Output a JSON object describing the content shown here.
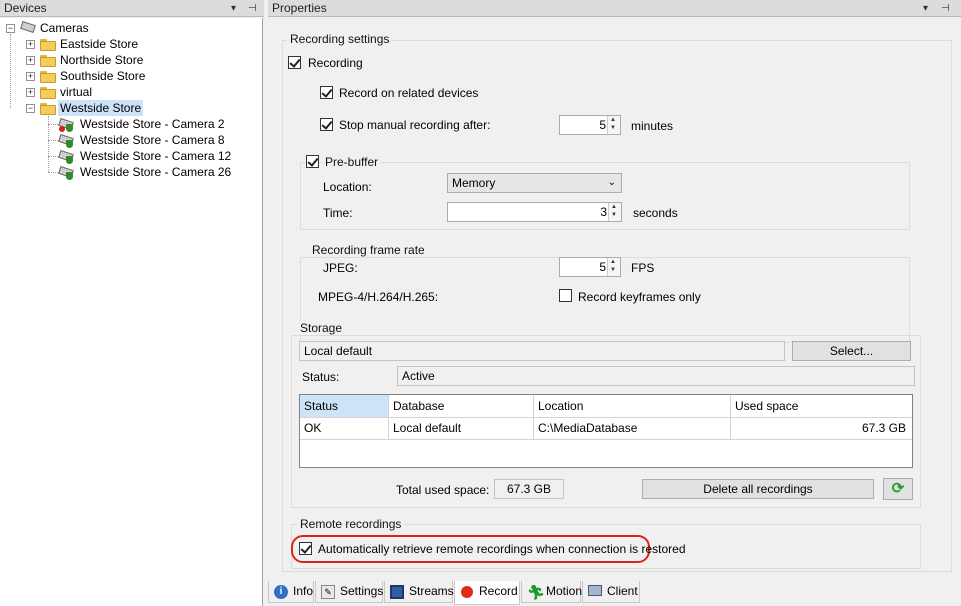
{
  "devices_pane": {
    "title": "Devices",
    "root": "Cameras",
    "folders": [
      "Eastside Store",
      "Northside Store",
      "Southside Store",
      "virtual",
      "Westside Store"
    ],
    "cameras": [
      "Westside Store - Camera 2",
      "Westside Store - Camera 8",
      "Westside Store - Camera 12",
      "Westside Store - Camera 26"
    ],
    "expander_plus": "+",
    "expander_minus": "−"
  },
  "properties_pane": {
    "title": "Properties",
    "pin_glyph": "▾ ⊣",
    "close_glyph": "✕"
  },
  "recording_settings": {
    "title": "Recording settings",
    "recording_label": "Recording",
    "recording_checked": true,
    "related_label": "Record on related devices",
    "related_checked": true,
    "stop_manual_label": "Stop manual recording after:",
    "stop_manual_checked": true,
    "stop_manual_value": "5",
    "stop_manual_unit": "minutes"
  },
  "prebuffer": {
    "title": "Pre-buffer",
    "checked": true,
    "location_label": "Location:",
    "location_value": "Memory",
    "time_label": "Time:",
    "time_value": "3",
    "time_unit": "seconds"
  },
  "frame_rate": {
    "title": "Recording frame rate",
    "jpeg_label": "JPEG:",
    "jpeg_value": "5",
    "jpeg_unit": "FPS",
    "mpeg_label": "MPEG-4/H.264/H.265:",
    "keyframes_label": "Record keyframes only",
    "keyframes_checked": false
  },
  "storage": {
    "title": "Storage",
    "name": "Local default",
    "select_button": "Select...",
    "status_label": "Status:",
    "status_value": "Active",
    "columns": [
      "Status",
      "Database",
      "Location",
      "Used space"
    ],
    "rows": [
      {
        "status": "OK",
        "database": "Local default",
        "location": "C:\\MediaDatabase",
        "used": "67.3 GB"
      }
    ],
    "total_label": "Total used space:",
    "total_value": "67.3 GB",
    "delete_button": "Delete all recordings"
  },
  "remote": {
    "title": "Remote recordings",
    "auto_label": "Automatically retrieve remote recordings when connection is restored",
    "auto_checked": true,
    "highlight_color": "#d9261c"
  },
  "tabs": [
    {
      "label": "Info",
      "icon": "info-icon"
    },
    {
      "label": "Settings",
      "icon": "settings-icon"
    },
    {
      "label": "Streams",
      "icon": "streams-icon"
    },
    {
      "label": "Record",
      "icon": "record-icon",
      "active": true
    },
    {
      "label": "Motion",
      "icon": "motion-icon"
    },
    {
      "label": "Client",
      "icon": "client-icon"
    }
  ]
}
